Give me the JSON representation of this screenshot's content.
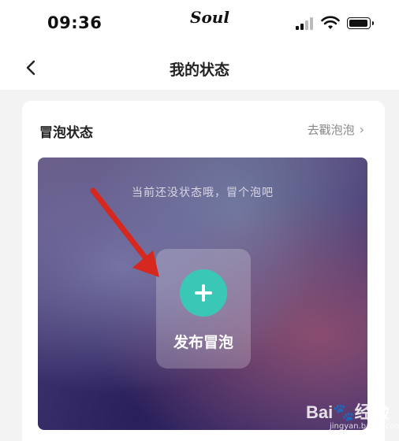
{
  "status_bar": {
    "time": "09:36",
    "carrier": "Soul"
  },
  "nav": {
    "title": "我的状态"
  },
  "card": {
    "title": "冒泡状态",
    "link_label": "去戳泡泡",
    "empty_hint": "当前还没状态哦，冒个泡吧",
    "publish_label": "发布冒泡"
  },
  "colors": {
    "accent": "#3bc7b5",
    "annotation_arrow": "#d6281f"
  },
  "watermark": {
    "brand": "Bai",
    "brand_cn": "经验",
    "url": "jingyan.baidu.com"
  }
}
